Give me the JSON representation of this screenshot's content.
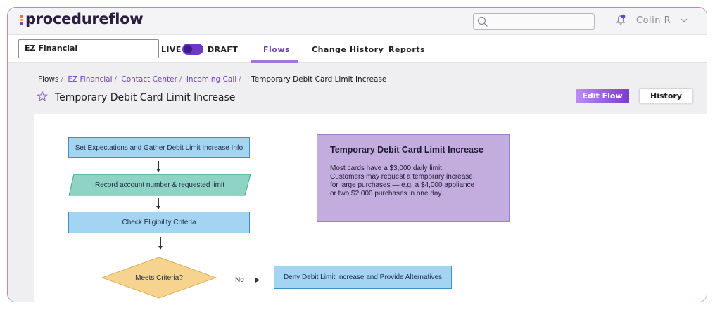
{
  "app": {
    "logo": "procedureflow",
    "logo_colors": [
      "#f06a4a",
      "#f3b13a",
      "#6a3fd0"
    ],
    "search": {
      "placeholder": "",
      "icon": "search-icon"
    },
    "user": {
      "name": "Colin R",
      "icon": "bell-icon"
    }
  },
  "nav": {
    "tenant": "EZ Financial",
    "live_label": "LIVE",
    "draft_label": "DRAFT",
    "mode": "draft",
    "tabs": [
      {
        "label": "Flows",
        "active": true
      },
      {
        "label": "Change History",
        "active": false
      },
      {
        "label": "Reports",
        "active": false
      }
    ]
  },
  "page": {
    "breadcrumb": [
      "Flows",
      "EZ Financial",
      "Contact Center",
      "Incoming Call"
    ],
    "current": "Temporary Debit Card Limit Increase",
    "title": "Temporary Debit Card Limit Increase",
    "edit_button": "Edit Flow",
    "history_button": "History"
  },
  "flow": {
    "steps": [
      "Set Expectations and Gather Debit Limit Increase Info",
      "Record account number & requested limit",
      "Check Eligibility Criteria",
      "Meets Criteria?",
      "Deny Debit Limit Increase and Provide Alternatives"
    ],
    "no_label": "No",
    "note": {
      "title": "Temporary Debit Card Limit Increase",
      "body": "Most cards have a $3,000 daily limit.\nCustomers may request a temporary increase\nfor large purchases — e.g. a $4,000 appliance\nor two $2,000 purchases in one day."
    }
  },
  "colors": {
    "accent": "#6b3fb9",
    "process_fill": "#a3d4f2",
    "io_fill": "#8fd3c5",
    "decision_fill": "#f6d48f",
    "note_fill": "#c3addf"
  }
}
